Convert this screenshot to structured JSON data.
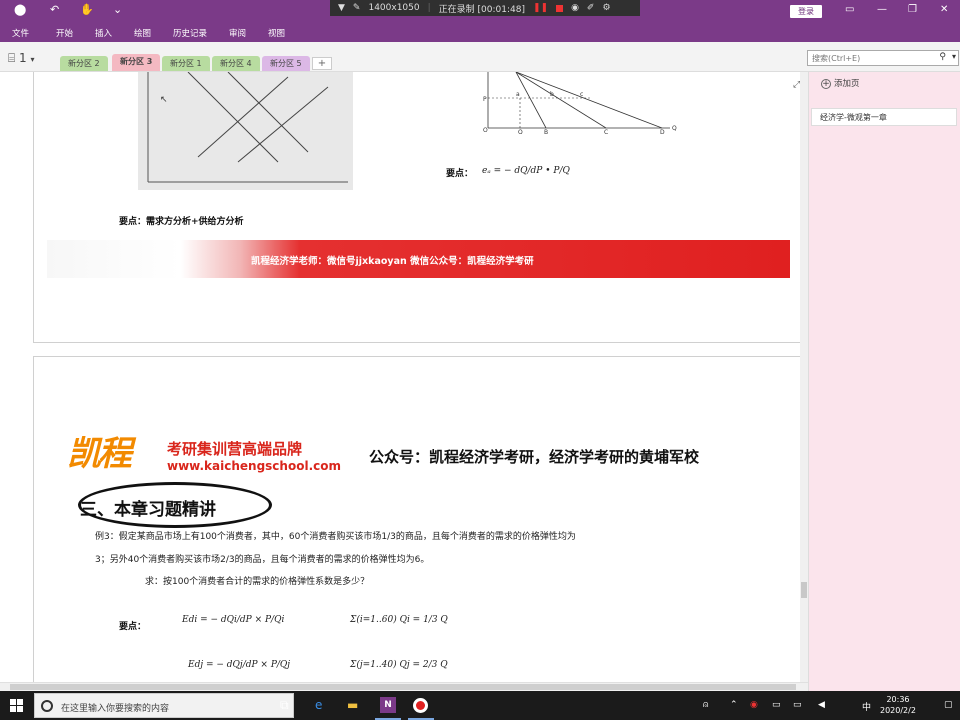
{
  "title_bar": {
    "undo": "↶",
    "touch": "✋",
    "customize": "⌄",
    "signin": "登录"
  },
  "recorder": {
    "resolution": "1400x1050",
    "status": "正在录制 [00:01:48]"
  },
  "ribbon": [
    "文件",
    "开始",
    "插入",
    "绘图",
    "历史记录",
    "审阅",
    "视图"
  ],
  "notebook": {
    "name": "1"
  },
  "sections": [
    {
      "label": "新分区 2",
      "color": "#b8dca0"
    },
    {
      "label": "新分区 3",
      "color": "#f4b9c2"
    },
    {
      "label": "新分区 1",
      "color": "#b8dca0"
    },
    {
      "label": "新分区 4",
      "color": "#b8dca0"
    },
    {
      "label": "新分区 5",
      "color": "#dcb8e6"
    }
  ],
  "search": {
    "placeholder": "搜索(Ctrl+E)"
  },
  "right_panel": {
    "add_page": "添加页",
    "page": "经济学-微观第一章"
  },
  "content": {
    "graph_labels": [
      "P",
      "O",
      "Q",
      "A",
      "B",
      "C",
      "D",
      "Q",
      "a",
      "b",
      "c"
    ],
    "formula_key": "要点：",
    "formula_ed": "eₐ = − dQ/dP • P/Q",
    "key_demand": "要点：需求方分析+供给方分析",
    "banner": "凯程经济学老师：微信号jjxkaoyan  微信公众号：凯程经济学考研",
    "logo_big": "凯程",
    "logo_line1": "考研集训营高端品牌",
    "logo_line2": "www.kaichengschool.com",
    "gongzhonghao": "公众号：凯程经济学考研，经济学考研的黄埔军校",
    "heading": "三、本章习题精讲",
    "example_line1": "例3：假定某商品市场上有100个消费者，其中，60个消费者购买该市场1/3的商品，且每个消费者的需求的价格弹性均为",
    "example_line2": "3；另外40个消费者购买该市场2/3的商品，且每个消费者的需求的价格弹性均为6。",
    "question": "求：按100个消费者合计的需求的价格弹性系数是多少？",
    "key_point": "要点：",
    "f1": "Edi = − dQi/dP × P/Qi",
    "f2": "Σ(i=1..60) Qi = 1/3 Q",
    "f3": "Edj = − dQj/dP × P/Qj",
    "f4": "Σ(j=1..40) Qj = 2/3 Q"
  },
  "taskbar": {
    "search_placeholder": "在这里输入你要搜索的内容",
    "onenote": "N",
    "time": "20:36",
    "date": "2020/2/2",
    "ime": "中"
  }
}
